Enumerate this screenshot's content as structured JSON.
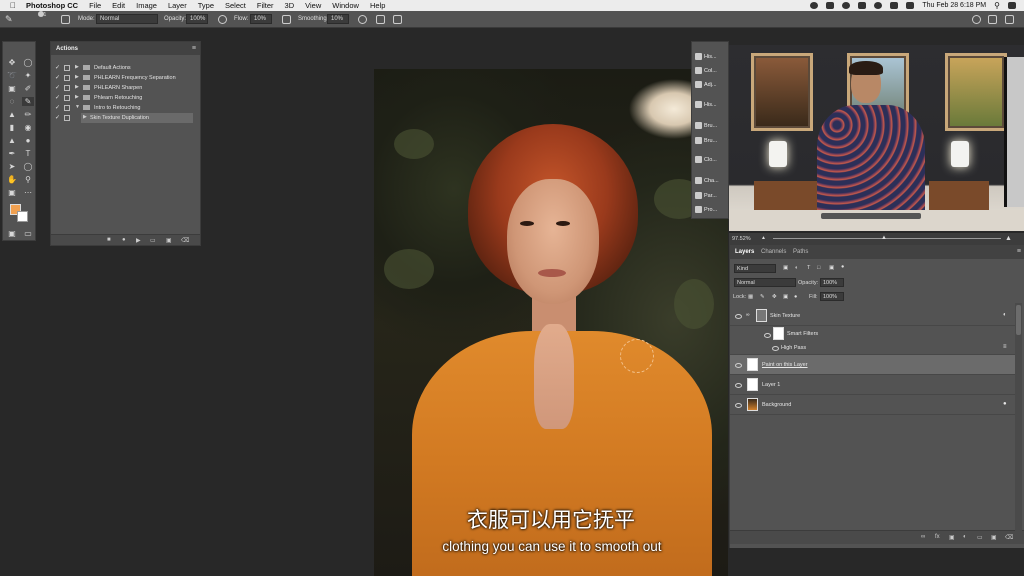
{
  "menubar": {
    "app_name": "Photoshop CC",
    "items": [
      "File",
      "Edit",
      "Image",
      "Layer",
      "Type",
      "Select",
      "Filter",
      "3D",
      "View",
      "Window",
      "Help"
    ],
    "clock": "Thu Feb 28  6:18 PM"
  },
  "options_bar": {
    "brush_size": "181",
    "mode_label": "Mode:",
    "mode_value": "Normal",
    "opacity_label": "Opacity:",
    "opacity_value": "100%",
    "flow_label": "Flow:",
    "flow_value": "10%",
    "smoothing_label": "Smoothing:",
    "smoothing_value": "10%"
  },
  "actions_panel": {
    "title": "Actions",
    "rows": [
      {
        "label": "Default Actions",
        "type": "set"
      },
      {
        "label": "PHLEARN Frequency Separation",
        "type": "set"
      },
      {
        "label": "PHLEARN Sharpen",
        "type": "set"
      },
      {
        "label": "Phlearn Retouching",
        "type": "set"
      },
      {
        "label": "Intro to Retouching",
        "type": "set"
      },
      {
        "label": "Skin Texture Duplication",
        "type": "action"
      }
    ]
  },
  "icon_strip": {
    "items": [
      "His...",
      "Col...",
      "Adj...",
      "His...",
      "Bru...",
      "Bru...",
      "Clo...",
      "Cha...",
      "Par...",
      "Pro..."
    ]
  },
  "video": {
    "zoom": "97.52%"
  },
  "layers_panel": {
    "tabs": [
      "Layers",
      "Channels",
      "Paths"
    ],
    "kind_label": "Kind",
    "blend_mode": "Normal",
    "opacity_label": "Opacity:",
    "opacity_value": "100%",
    "lock_label": "Lock:",
    "fill_label": "Fill:",
    "fill_value": "100%",
    "layers": [
      {
        "name": "Skin Texture",
        "kind": "smart-object"
      },
      {
        "name": "Smart Filters",
        "kind": "filter-mask"
      },
      {
        "name": "High Pass",
        "kind": "filter"
      },
      {
        "name": "Paint on this Layer",
        "kind": "pixel",
        "selected": true
      },
      {
        "name": "Layer 1",
        "kind": "pixel"
      },
      {
        "name": "Background",
        "kind": "background"
      }
    ]
  },
  "subtitles": {
    "chinese": "衣服可以用它抚平",
    "english": "clothing you can use it to smooth out"
  },
  "colors": {
    "foreground": "#f0a050",
    "background": "#ffffff",
    "panel": "#535353"
  }
}
